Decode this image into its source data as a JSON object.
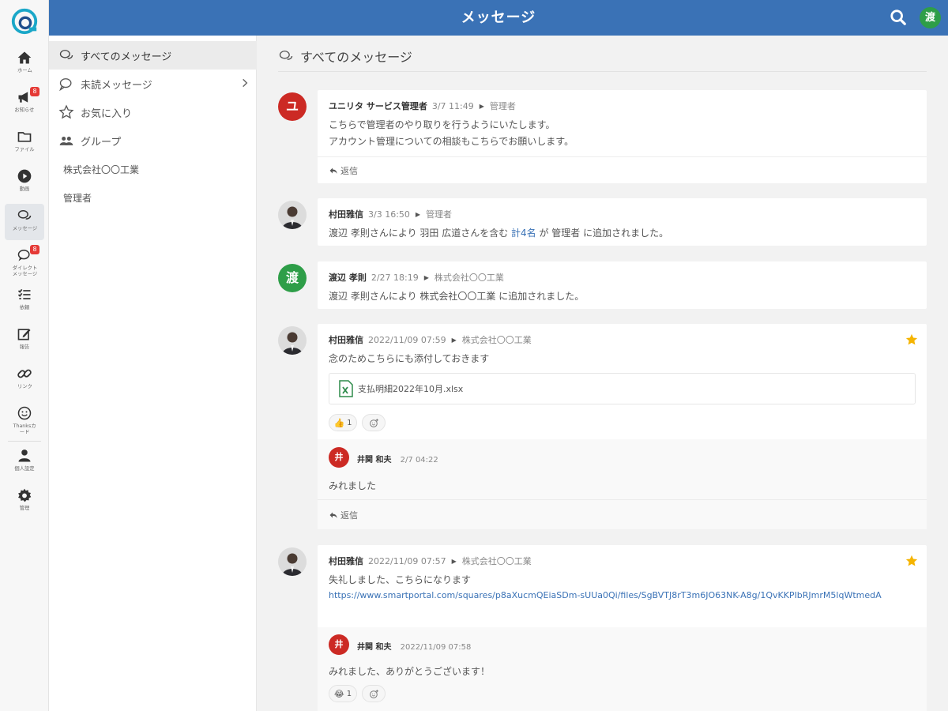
{
  "header": {
    "title": "メッセージ",
    "user_initial": "渡"
  },
  "rail": {
    "items": [
      {
        "label": "ホーム",
        "icon": "home-icon"
      },
      {
        "label": "お知らせ",
        "icon": "megaphone-icon",
        "badge": "8"
      },
      {
        "label": "ファイル",
        "icon": "folder-icon"
      },
      {
        "label": "動画",
        "icon": "play-icon"
      },
      {
        "label": "メッセージ",
        "icon": "chat-bubbles-icon"
      },
      {
        "label": "ダイレクト\nメッセージ",
        "label1": "ダイレクト",
        "label2": "メッセージ",
        "icon": "chat-icon",
        "badge": "8"
      },
      {
        "label": "依頼",
        "icon": "checklist-icon"
      },
      {
        "label": "報告",
        "icon": "edit-icon"
      },
      {
        "label": "リンク",
        "icon": "link-icon"
      },
      {
        "label1": "Thanksカ",
        "label2": "ード",
        "icon": "smile-icon"
      },
      {
        "label": "個人設定",
        "icon": "user-icon"
      },
      {
        "label": "管理",
        "icon": "gear-icon"
      }
    ]
  },
  "subnav": {
    "items": [
      {
        "label": "すべてのメッセージ"
      },
      {
        "label": "未読メッセージ"
      },
      {
        "label": "お気に入り"
      },
      {
        "label": "グループ"
      },
      {
        "label": "株式会社〇〇工業"
      },
      {
        "label": "管理者"
      }
    ]
  },
  "main": {
    "title": "すべてのメッセージ",
    "reply_label": "返信",
    "messages": [
      {
        "avatar": "ユ",
        "author": "ユニリタ サービス管理者",
        "time": "3/7 11:49",
        "channel": "管理者",
        "lines": [
          "こちらで管理者のやり取りを行うようにいたします。",
          "アカウント管理についての相談もこちらでお願いします。"
        ]
      },
      {
        "author": "村田雅信",
        "time": "3/3 16:50",
        "channel": "管理者",
        "text_pre": "渡辺 孝則さんにより 羽田 広道さんを含む ",
        "text_link": "計4名",
        "text_post": " が 管理者 に追加されました。"
      },
      {
        "avatar": "渡",
        "author": "渡辺 孝則",
        "time": "2/27 18:19",
        "channel": "株式会社〇〇工業",
        "text": "渡辺 孝則さんにより 株式会社〇〇工業 に追加されました。"
      },
      {
        "author": "村田雅信",
        "time": "2022/11/09 07:59",
        "channel": "株式会社〇〇工業",
        "text": "念のためこちらにも添付しておきます",
        "attachment": "支払明細2022年10月.xlsx",
        "reaction_count": "1",
        "reply": {
          "avatar": "井",
          "author": "井関 和夫",
          "time": "2/7 04:22",
          "text": "みれました"
        }
      },
      {
        "author": "村田雅信",
        "time": "2022/11/09 07:57",
        "channel": "株式会社〇〇工業",
        "text": "失礼しました、こちらになります",
        "url": "https://www.smartportal.com/squares/p8aXucmQEiaSDm-sUUa0Qi/files/SgBVTJ8rT3m6JO63NK-A8g/1QvKKPIbRJmrM5lqWtmedA",
        "reply": {
          "avatar": "井",
          "author": "井関 和夫",
          "time": "2022/11/09 07:58",
          "text": "みれました、ありがとうございます！",
          "reaction_count": "1"
        }
      }
    ]
  },
  "colors": {
    "header": "#3a72b6",
    "accent_red": "#cc2a24",
    "accent_green": "#2e9e48",
    "star": "#f5b400"
  }
}
